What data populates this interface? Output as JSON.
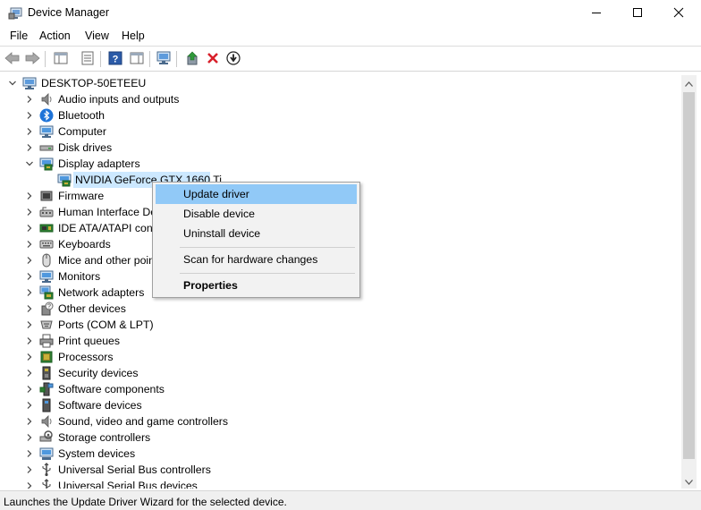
{
  "window": {
    "title": "Device Manager"
  },
  "menubar": {
    "items": [
      "File",
      "Action",
      "View",
      "Help"
    ]
  },
  "toolbar": {
    "buttons": [
      "back-arrow-icon",
      "forward-arrow-icon",
      "show-hide-console-tree-icon",
      "properties-icon",
      "help-icon",
      "action-pane-icon",
      "scan-hardware-icon",
      "update-driver-icon",
      "uninstall-device-icon",
      "disable-device-icon"
    ]
  },
  "tree": {
    "root": "DESKTOP-50ETEEU",
    "categories": [
      {
        "label": "Audio inputs and outputs",
        "icon": "speaker-icon"
      },
      {
        "label": "Bluetooth",
        "icon": "bluetooth-icon"
      },
      {
        "label": "Computer",
        "icon": "monitor-icon"
      },
      {
        "label": "Disk drives",
        "icon": "disk-drive-icon"
      },
      {
        "label": "Display adapters",
        "icon": "display-adapter-icon",
        "expanded": true
      },
      {
        "label": "NVIDIA GeForce GTX 1660 Ti",
        "icon": "display-adapter-icon",
        "child": true,
        "selected": true
      },
      {
        "label": "Firmware",
        "icon": "firmware-icon"
      },
      {
        "label": "Human Interface De",
        "icon": "hid-icon"
      },
      {
        "label": "IDE ATA/ATAPI contr",
        "icon": "ide-controller-icon"
      },
      {
        "label": "Keyboards",
        "icon": "keyboard-icon"
      },
      {
        "label": "Mice and other poin",
        "icon": "mouse-icon"
      },
      {
        "label": "Monitors",
        "icon": "monitor-icon"
      },
      {
        "label": "Network adapters",
        "icon": "network-adapter-icon"
      },
      {
        "label": "Other devices",
        "icon": "unknown-device-icon"
      },
      {
        "label": "Ports (COM & LPT)",
        "icon": "port-icon"
      },
      {
        "label": "Print queues",
        "icon": "printer-icon"
      },
      {
        "label": "Processors",
        "icon": "processor-icon"
      },
      {
        "label": "Security devices",
        "icon": "security-device-icon"
      },
      {
        "label": "Software components",
        "icon": "software-component-icon"
      },
      {
        "label": "Software devices",
        "icon": "software-device-icon"
      },
      {
        "label": "Sound, video and game controllers",
        "icon": "speaker-icon"
      },
      {
        "label": "Storage controllers",
        "icon": "storage-controller-icon"
      },
      {
        "label": "System devices",
        "icon": "system-devices-icon"
      },
      {
        "label": "Universal Serial Bus controllers",
        "icon": "usb-icon"
      },
      {
        "label": "Universal Serial Bus devices",
        "icon": "usb-icon"
      }
    ]
  },
  "context_menu": {
    "items": [
      {
        "label": "Update driver",
        "highlighted": true
      },
      {
        "label": "Disable device"
      },
      {
        "label": "Uninstall device"
      },
      {
        "label": "Scan for hardware changes"
      },
      {
        "label": "Properties",
        "bold": true
      }
    ]
  },
  "statusbar": {
    "text": "Launches the Update Driver Wizard for the selected device."
  },
  "colors": {
    "selection": "#cce8ff",
    "menu_highlight": "#91c9f7",
    "red_x": "#d8202a",
    "green": "#2f9a3a"
  }
}
